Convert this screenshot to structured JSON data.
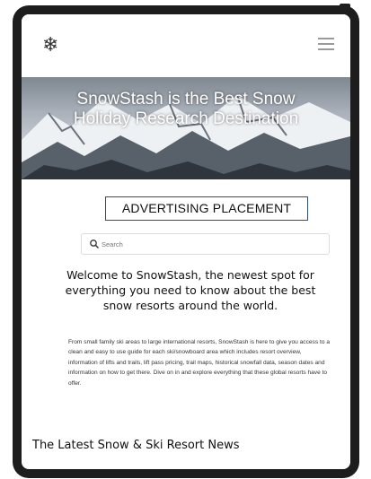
{
  "nav": {
    "logo_icon": "snowflake-icon",
    "menu_icon": "hamburger-menu-icon"
  },
  "hero": {
    "title": "SnowStash is the Best Snow Holiday Research Destination"
  },
  "ad": {
    "label": "ADVERTISING PLACEMENT"
  },
  "search": {
    "placeholder": "Search",
    "icon": "search-icon"
  },
  "welcome": {
    "heading": "Welcome to SnowStash, the newest spot for everything you need to know about the best snow resorts around the world."
  },
  "intro": {
    "text": "From small family ski areas to large international resorts, SnowStash is here to give you access to a clean and easy to use guide for each ski/snowboard area which includes resort overview, information of lifts and trails, lift pass pricing, trail maps, historical snowfall data, season dates and information on how to get there. Dive on in and explore everything that these global resorts have to offer."
  },
  "news": {
    "heading": "The Latest Snow & Ski Resort News"
  },
  "colors": {
    "device_frame": "#1d1d1d",
    "ad_border": "#2f4c7a",
    "text": "#111111"
  }
}
